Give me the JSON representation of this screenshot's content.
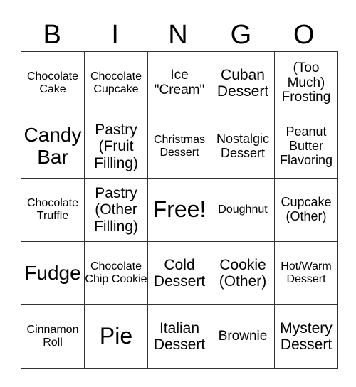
{
  "header": [
    "B",
    "I",
    "N",
    "G",
    "O"
  ],
  "cells": [
    [
      "Chocolate Cake",
      "Chocolate Cupcake",
      "Ice \"Cream\"",
      "Cuban Dessert",
      "(Too Much) Frosting"
    ],
    [
      "Candy Bar",
      "Pastry (Fruit Filling)",
      "Christmas Dessert",
      "Nostalgic Dessert",
      "Peanut Butter Flavoring"
    ],
    [
      "Chocolate Truffle",
      "Pastry (Other Filling)",
      "Free!",
      "Doughnut",
      "Cupcake (Other)"
    ],
    [
      "Fudge",
      "Chocolate Chip Cookie",
      "Cold Dessert",
      "Cookie (Other)",
      "Hot/Warm Dessert"
    ],
    [
      "Cinnamon Roll",
      "Pie",
      "Italian Dessert",
      "Brownie",
      "Mystery Dessert"
    ]
  ]
}
